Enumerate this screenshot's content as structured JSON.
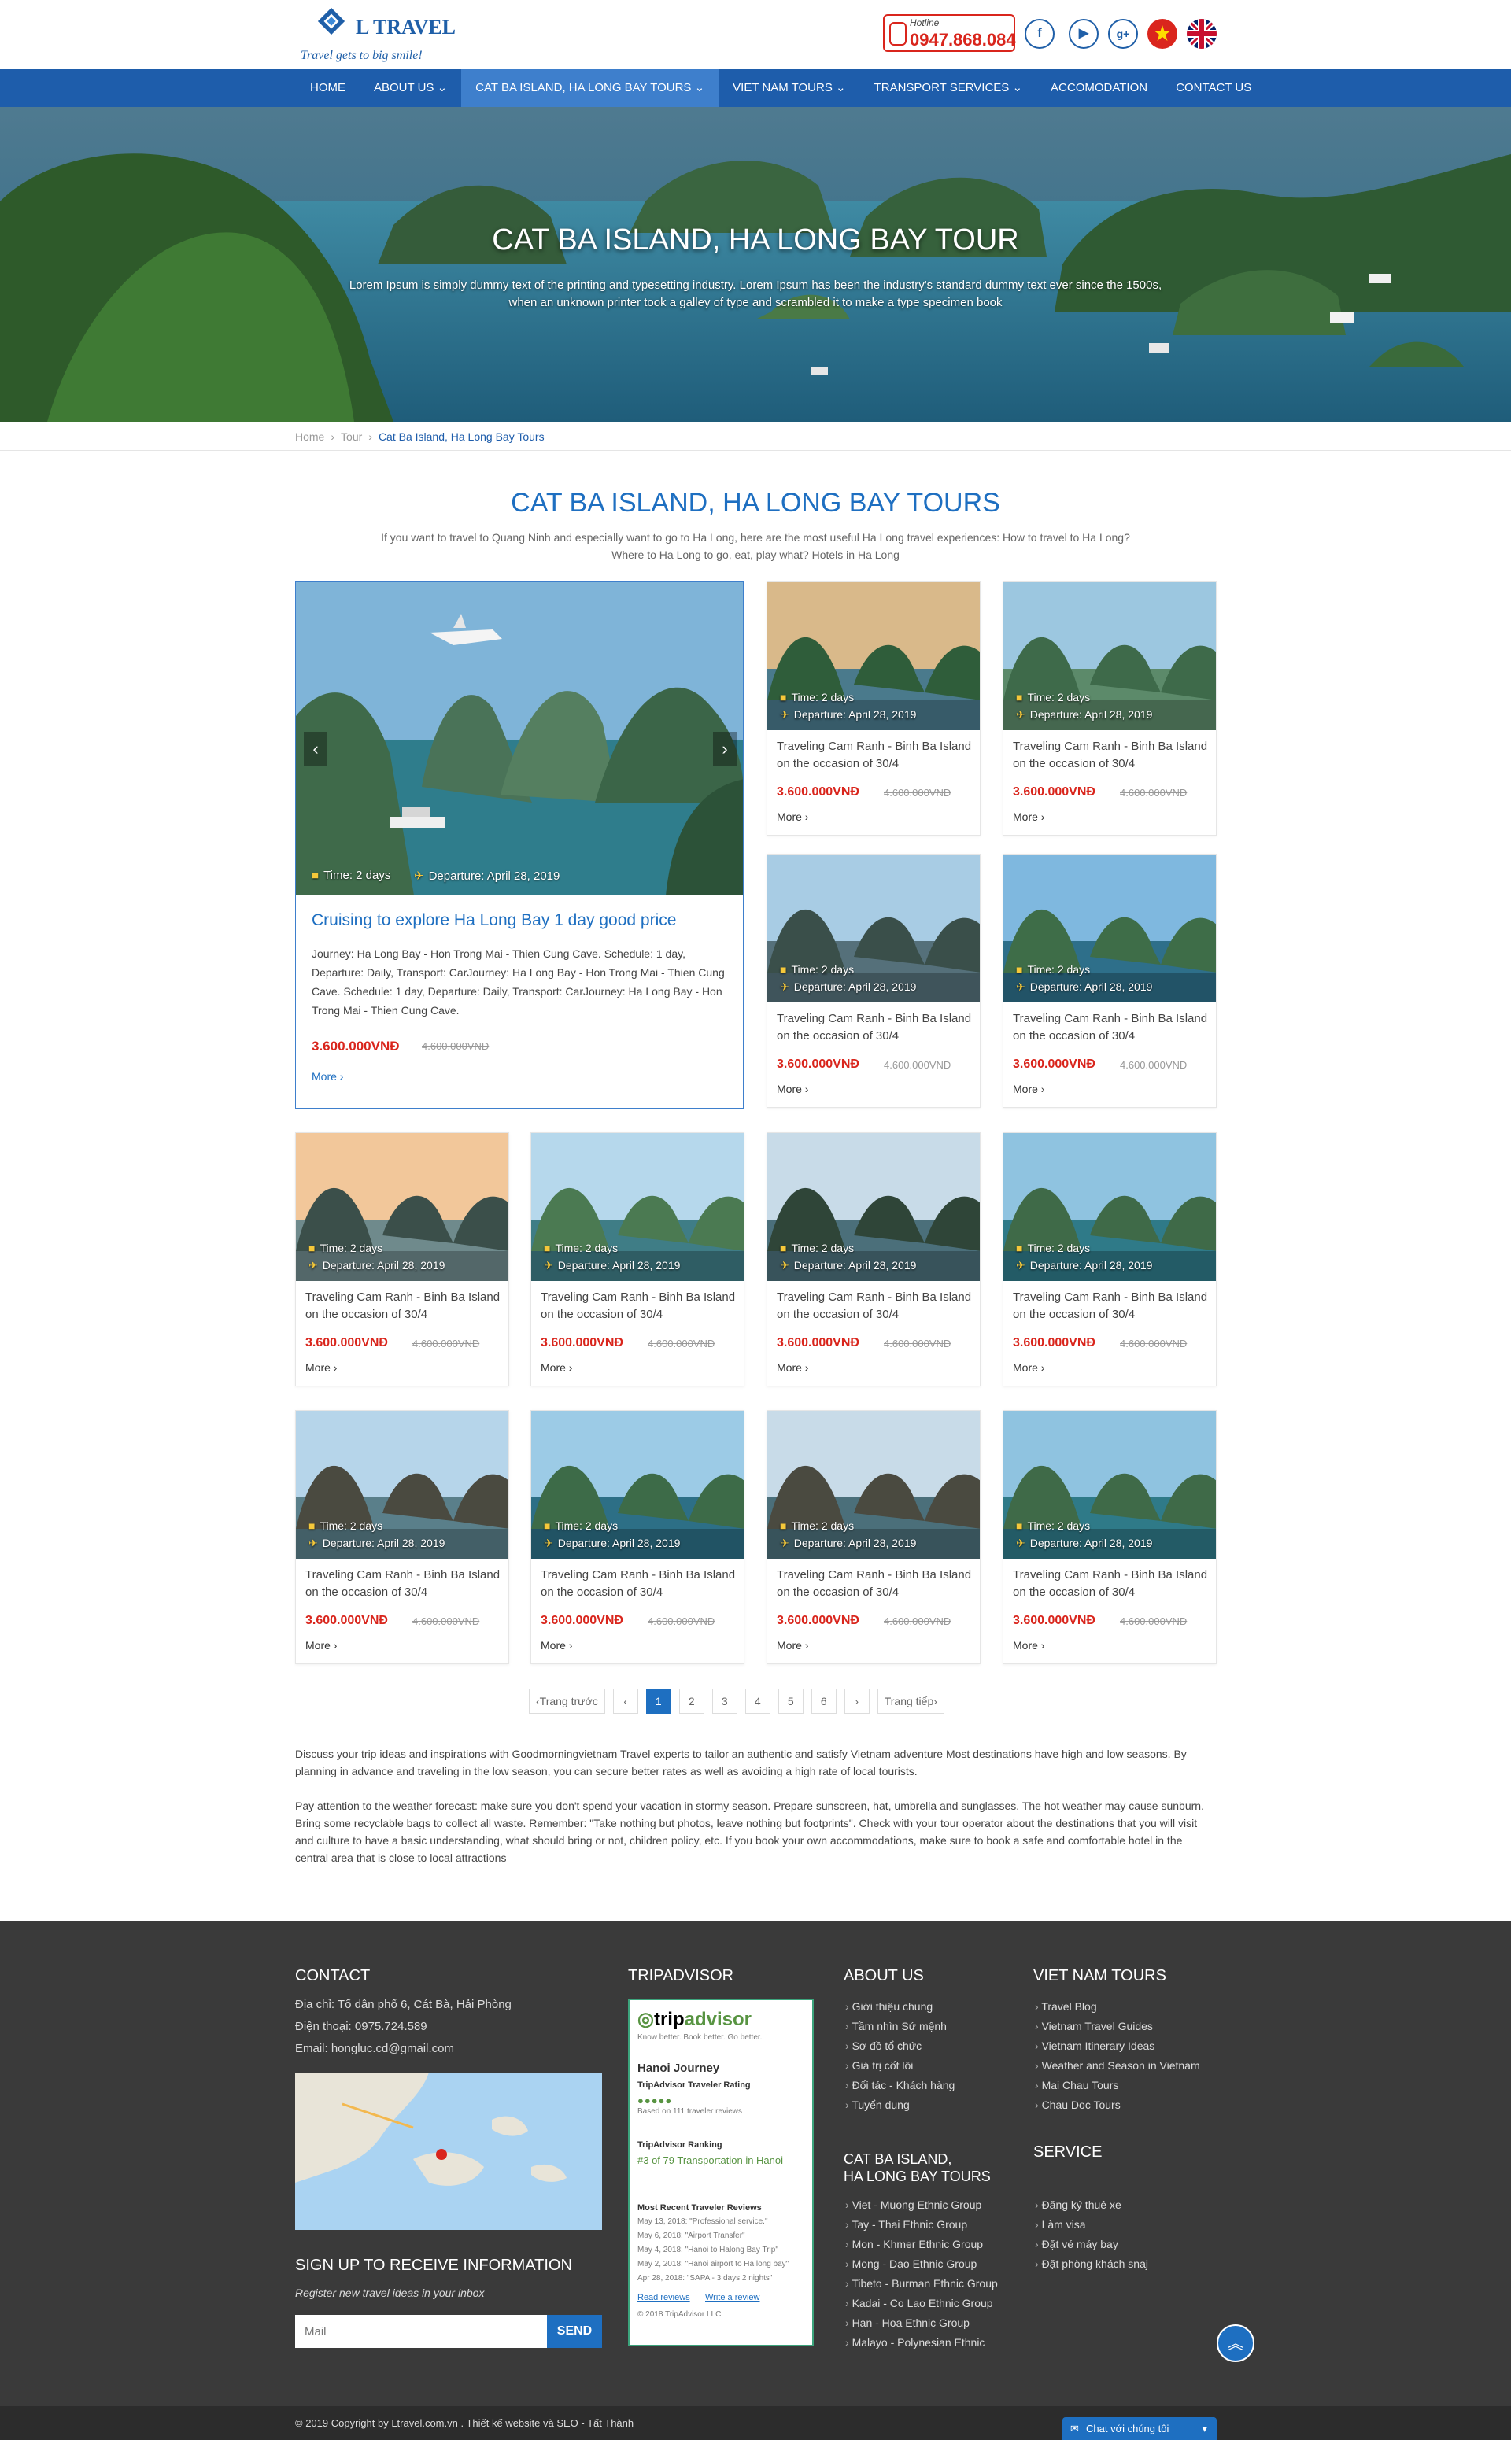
{
  "header": {
    "brand": "L TRAVEL",
    "tagline": "Travel gets to big smile!",
    "hotline_label": "Hotline",
    "hotline_number": "0947.868.084",
    "social": [
      "f",
      "▶",
      "g+"
    ]
  },
  "nav": {
    "items": [
      {
        "label": "HOME"
      },
      {
        "label": "ABOUT US ⌄"
      },
      {
        "label": "CAT BA ISLAND, HA LONG BAY TOURS ⌄"
      },
      {
        "label": "VIET NAM TOURS ⌄"
      },
      {
        "label": "TRANSPORT SERVICES ⌄"
      },
      {
        "label": "ACCOMODATION"
      },
      {
        "label": "CONTACT US"
      }
    ]
  },
  "hero": {
    "title": "CAT BA ISLAND, HA LONG BAY TOUR",
    "text": "Lorem Ipsum is simply dummy text of the printing and typesetting industry. Lorem Ipsum has been the industry's standard dummy text ever since the 1500s, when an unknown printer took a galley of type and scrambled it to make a type specimen book"
  },
  "breadcrumb": [
    "Home",
    "›",
    "Tour",
    "›",
    "Cat Ba Island, Ha Long Bay Tours"
  ],
  "section": {
    "title": "CAT BA ISLAND, HA LONG BAY TOURS",
    "intro": "If you want to travel to Quang Ninh and especially want to go to Ha Long, here are the most useful Ha Long travel experiences: How to travel to Ha Long? Where to Ha Long to go, eat, play what? Hotels in Ha Long"
  },
  "featured": {
    "time": "Time: 2 days",
    "departure": "Departure: April 28, 2019",
    "title": "Cruising to explore Ha Long Bay 1 day good price",
    "desc": "Journey: Ha Long Bay - Hon Trong Mai - Thien Cung Cave. Schedule: 1 day, Departure: Daily, Transport: CarJourney: Ha Long Bay - Hon Trong Mai - Thien Cung Cave. Schedule: 1 day, Departure: Daily, Transport: CarJourney: Ha Long Bay - Hon Trong Mai - Thien Cung Cave.",
    "price": "3.600.000VNĐ",
    "old_price": "4.600.000VNĐ",
    "more": "More ›"
  },
  "cards": [
    {
      "time": "Time: 2 days",
      "departure": "Departure: April 28, 2019",
      "title": "Traveling Cam Ranh - Binh Ba Island on the occasion of 30/4",
      "price": "3.600.000VNĐ",
      "old_price": "4.600.000VNĐ",
      "more": "More ›"
    },
    {
      "time": "Time: 2 days",
      "departure": "Departure: April 28, 2019",
      "title": "Traveling Cam Ranh - Binh Ba Island on the occasion of 30/4",
      "price": "3.600.000VNĐ",
      "old_price": "4.600.000VNĐ",
      "more": "More ›"
    },
    {
      "time": "Time: 2 days",
      "departure": "Departure: April 28, 2019",
      "title": "Traveling Cam Ranh - Binh Ba Island on the occasion of 30/4",
      "price": "3.600.000VNĐ",
      "old_price": "4.600.000VNĐ",
      "more": "More ›"
    },
    {
      "time": "Time: 2 days",
      "departure": "Departure: April 28, 2019",
      "title": "Traveling Cam Ranh - Binh Ba Island on the occasion of 30/4",
      "price": "3.600.000VNĐ",
      "old_price": "4.600.000VNĐ",
      "more": "More ›"
    },
    {
      "time": "Time: 2 days",
      "departure": "Departure: April 28, 2019",
      "title": "Traveling Cam Ranh - Binh Ba Island on the occasion of 30/4",
      "price": "3.600.000VNĐ",
      "old_price": "4.600.000VNĐ",
      "more": "More ›"
    },
    {
      "time": "Time: 2 days",
      "departure": "Departure: April 28, 2019",
      "title": "Traveling Cam Ranh - Binh Ba Island on the occasion of 30/4",
      "price": "3.600.000VNĐ",
      "old_price": "4.600.000VNĐ",
      "more": "More ›"
    },
    {
      "time": "Time: 2 days",
      "departure": "Departure: April 28, 2019",
      "title": "Traveling Cam Ranh - Binh Ba Island on the occasion of 30/4",
      "price": "3.600.000VNĐ",
      "old_price": "4.600.000VNĐ",
      "more": "More ›"
    },
    {
      "time": "Time: 2 days",
      "departure": "Departure: April 28, 2019",
      "title": "Traveling Cam Ranh - Binh Ba Island on the occasion of 30/4",
      "price": "3.600.000VNĐ",
      "old_price": "4.600.000VNĐ",
      "more": "More ›"
    },
    {
      "time": "Time: 2 days",
      "departure": "Departure: April 28, 2019",
      "title": "Traveling Cam Ranh - Binh Ba Island on the occasion of 30/4",
      "price": "3.600.000VNĐ",
      "old_price": "4.600.000VNĐ",
      "more": "More ›"
    },
    {
      "time": "Time: 2 days",
      "departure": "Departure: April 28, 2019",
      "title": "Traveling Cam Ranh - Binh Ba Island on the occasion of 30/4",
      "price": "3.600.000VNĐ",
      "old_price": "4.600.000VNĐ",
      "more": "More ›"
    },
    {
      "time": "Time: 2 days",
      "departure": "Departure: April 28, 2019",
      "title": "Traveling Cam Ranh - Binh Ba Island on the occasion of 30/4",
      "price": "3.600.000VNĐ",
      "old_price": "4.600.000VNĐ",
      "more": "More ›"
    },
    {
      "time": "Time: 2 days",
      "departure": "Departure: April 28, 2019",
      "title": "Traveling Cam Ranh - Binh Ba Island on the occasion of 30/4",
      "price": "3.600.000VNĐ",
      "old_price": "4.600.000VNĐ",
      "more": "More ›"
    }
  ],
  "pager": [
    "‹Trang trước",
    "‹",
    "1",
    "2",
    "3",
    "4",
    "5",
    "6",
    "›",
    "Trang tiếp›"
  ],
  "body_text": [
    "Discuss your trip ideas and inspirations with Goodmorningvietnam Travel experts to tailor an authentic and satisfy Vietnam adventure Most destinations have high and low seasons. By planning in advance and traveling in the low season, you can secure better rates as well as avoiding a high rate of local tourists.",
    "Pay attention to the weather forecast: make sure you don't spend your vacation in stormy season. Prepare sunscreen, hat, umbrella and sunglasses. The hot weather may cause sunburn. Bring some recyclable bags to collect all waste. Remember: \"Take nothing but photos, leave nothing but footprints\". Check with your tour operator about the destinations that you will visit and culture to have a basic understanding, what should bring or not, children policy, etc. If you book your own accommodations, make sure to book a safe and comfortable hotel in the central area that is close to local attractions"
  ],
  "footer": {
    "contact_title": "CONTACT",
    "address": "Địa chỉ: Tổ dân phố 6, Cát Bà, Hải Phòng",
    "phone": "Điện thoại: 0975.724.589",
    "email": "Email: hongluc.cd@gmail.com",
    "signup_title": "SIGN UP TO RECEIVE INFORMATION",
    "signup_sub": "Register new travel ideas in your inbox",
    "mail_placeholder": "Mail",
    "send": "SEND",
    "tripadvisor_title": "TRIPADVISOR",
    "ta": {
      "logo_a": "trip",
      "logo_b": "advisor",
      "slogan": "Know better. Book better. Go better.",
      "hotel": "Hanoi Journey",
      "rating_label": "TripAdvisor Traveler Rating",
      "based": "Based on 111 traveler reviews",
      "ranking_label": "TripAdvisor Ranking",
      "rank": "#3 of 79 Transportation in Hanoi",
      "recent_label": "Most Recent Traveler Reviews",
      "reviews": [
        "May 13, 2018: \"Professional service.\"",
        "May 6, 2018: \"Airport Transfer\"",
        "May 4, 2018: \"Hanoi to Halong Bay Trip\"",
        "May 2, 2018: \"Hanoi airport to Ha long bay\"",
        "Apr 28, 2018: \"SAPA - 3 days 2 nights\""
      ],
      "read": "Read reviews",
      "write": "Write a review",
      "copy": "© 2018 TripAdvisor LLC"
    },
    "about_title": "ABOUT US",
    "about_items": [
      "Giới thiệu chung",
      "Tầm nhìn Sứ mệnh",
      "Sơ đồ tổ chức",
      "Giá trị cốt lõi",
      "Đối tác - Khách hàng",
      "Tuyển dụng"
    ],
    "catba_title_1": "CAT BA ISLAND,",
    "catba_title_2": "HA LONG BAY TOURS",
    "catba_items": [
      "Viet - Muong Ethnic Group",
      "Tay - Thai Ethnic Group",
      "Mon - Khmer Ethnic Group",
      "Mong - Dao Ethnic Group",
      "Tibeto - Burman Ethnic Group",
      "Kadai - Co Lao Ethnic Group",
      "Han - Hoa Ethnic Group",
      "Malayo - Polynesian Ethnic"
    ],
    "vn_title": "VIET NAM TOURS",
    "vn_items": [
      "Travel Blog",
      "Vietnam Travel Guides",
      "Vietnam Itinerary Ideas",
      "Weather and Season in Vietnam",
      "Mai Chau Tours",
      "Chau Doc Tours"
    ],
    "service_title": "SERVICE",
    "service_items": [
      "Đăng ký thuê xe",
      "Làm visa",
      "Đặt vé máy bay",
      "Đặt phòng khách snaj"
    ],
    "copyright": "© 2019 Copyright by Ltravel.com.vn . Thiết kế website và SEO - Tất Thành",
    "chat": "Chat với chúng tôi"
  }
}
